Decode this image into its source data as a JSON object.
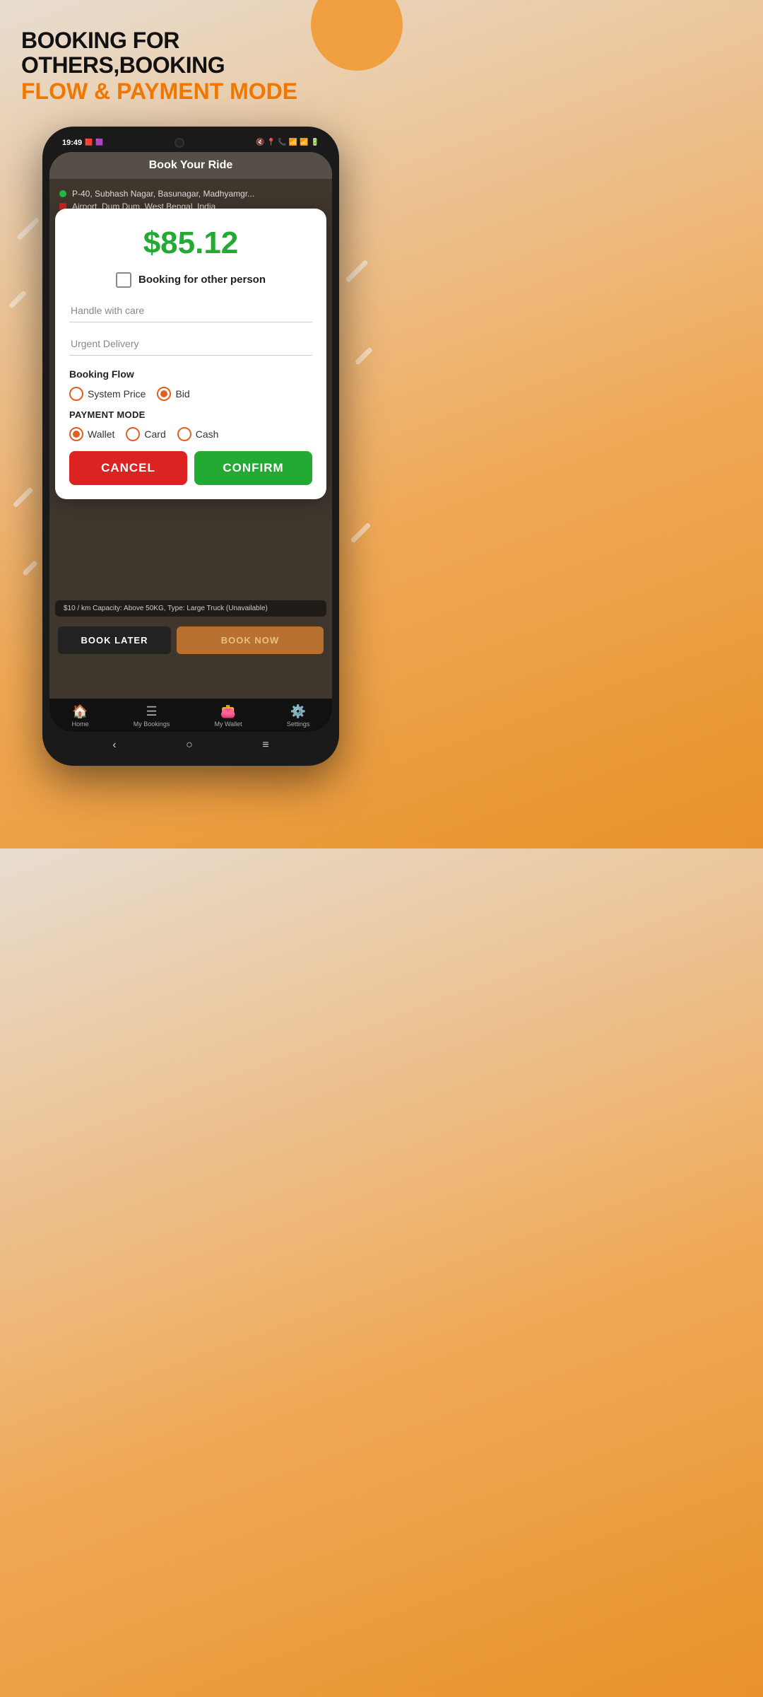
{
  "header": {
    "line1": "BOOKING FOR OTHERS,BOOKING",
    "line2": "FLOW & PAYMENT MODE"
  },
  "modal": {
    "price": "$85.12",
    "booking_other_label": "Booking for other person",
    "input1_placeholder": "Handle with care",
    "input2_placeholder": "Urgent Delivery",
    "booking_flow_label": "Booking Flow",
    "radio_system_price": "System Price",
    "radio_bid": "Bid",
    "payment_mode_label": "PAYMENT MODE",
    "radio_wallet": "Wallet",
    "radio_card": "Card",
    "radio_cash": "Cash",
    "cancel_btn": "CANCEL",
    "confirm_btn": "CONFIRM"
  },
  "app": {
    "book_ride_title": "Book Your Ride",
    "pickup": "P-40, Subhash Nagar, Basunagar, Madhyamgr...",
    "dropoff": "Airport, Dum Dum, West Bengal, India",
    "vehicle_info": "$10 / km  Capacity: Above 50KG, Type: Large Truck (Unavailable)",
    "book_later_btn": "BOOK LATER",
    "book_now_btn": "BOOK NOW"
  },
  "status_bar": {
    "time": "19:49"
  },
  "nav": {
    "home": "Home",
    "my_bookings": "My Bookings",
    "my_wallet": "My Wallet",
    "settings": "Settings"
  }
}
